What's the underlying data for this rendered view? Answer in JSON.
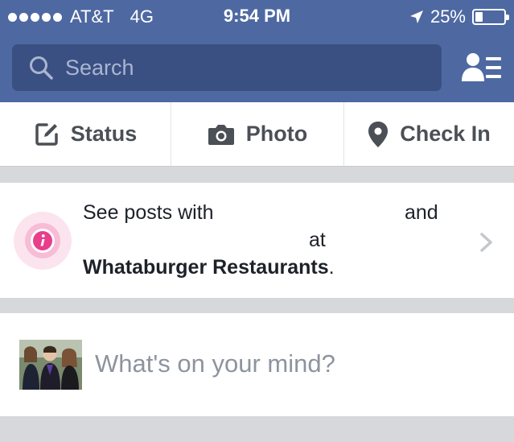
{
  "status_bar": {
    "carrier": "AT&T",
    "network": "4G",
    "time": "9:54 PM",
    "battery_percent": "25%",
    "battery_level": 0.25,
    "signal_dots": 5
  },
  "search": {
    "placeholder": "Search",
    "icon": "search-icon"
  },
  "header": {
    "friends_icon": "friend-requests-icon"
  },
  "actions": [
    {
      "label": "Status",
      "icon": "compose-icon"
    },
    {
      "label": "Photo",
      "icon": "camera-icon"
    },
    {
      "label": "Check In",
      "icon": "location-pin-icon"
    }
  ],
  "promo": {
    "line1_start": "See posts with",
    "line1_end": "and",
    "line2": "at",
    "venue": "Whataburger Restaurants",
    "period": "."
  },
  "composer": {
    "placeholder": "What's on your mind?"
  },
  "colors": {
    "header_bg": "#4e69a2",
    "search_bg": "#3a5083",
    "feed_bg": "#d6d8dc",
    "action_text": "#4b4f56",
    "info_accent": "#e83e8c"
  }
}
